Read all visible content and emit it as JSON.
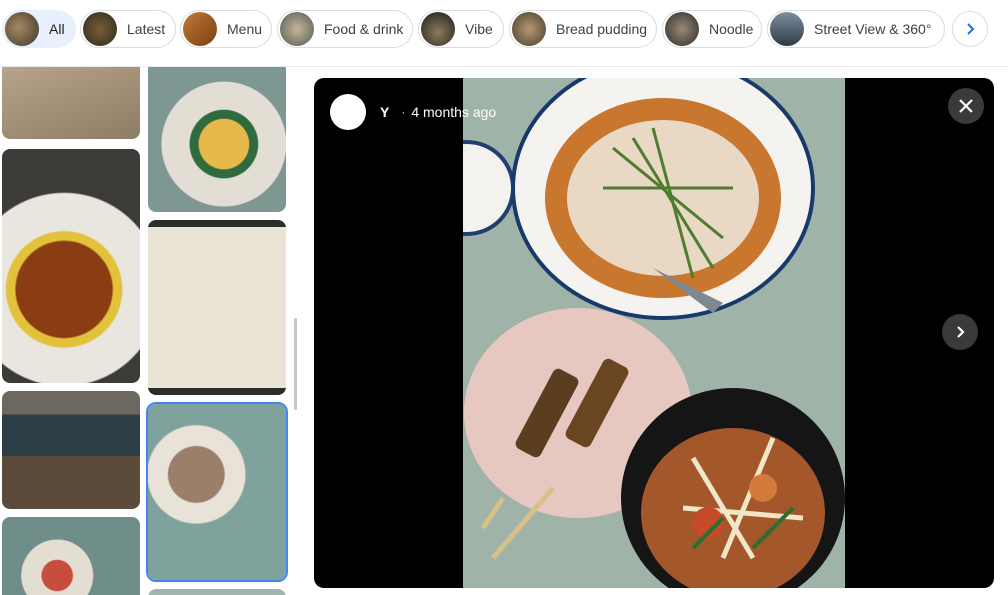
{
  "chips": [
    {
      "label": "All",
      "active": true,
      "thumb_color": "#6b5a44"
    },
    {
      "label": "Latest",
      "active": false,
      "thumb_color": "#5b4a2f"
    },
    {
      "label": "Menu",
      "active": false,
      "thumb_color": "#9a5a25"
    },
    {
      "label": "Food & drink",
      "active": false,
      "thumb_color": "#7a6a55"
    },
    {
      "label": "Vibe",
      "active": false,
      "thumb_color": "#2d2b26"
    },
    {
      "label": "Bread pudding",
      "active": false,
      "thumb_color": "#6e5a42"
    },
    {
      "label": "Noodle",
      "active": false,
      "thumb_color": "#3b3a38"
    },
    {
      "label": "Street View & 360°",
      "active": false,
      "thumb_color": "#4a5a6a"
    }
  ],
  "viewer": {
    "author": "Y",
    "separator": "·",
    "time": "4 months ago"
  },
  "icons": {
    "next_chips": "chevron-right-icon",
    "close": "close-icon",
    "next_photo": "chevron-right-icon"
  },
  "colors": {
    "chip_active_bg": "#e8f0fe",
    "selection_outline": "#4285f4",
    "viewer_bg": "#000000"
  }
}
